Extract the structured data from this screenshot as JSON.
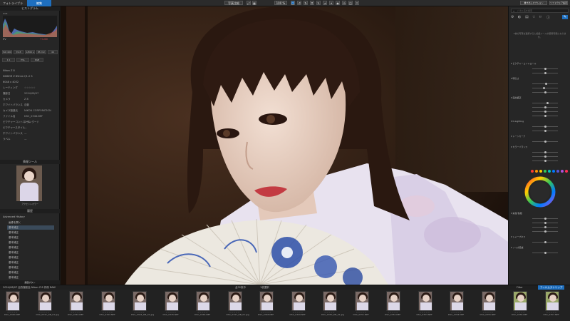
{
  "topbar": {
    "tab_library": "フォトライブラリ",
    "tab_edit": "編集",
    "mode_label": "写真比較",
    "zoom": "100 %",
    "left_tools": [
      "⤢",
      "☰"
    ],
    "right_btn1": "書き出しオプション",
    "right_btn2": "ソフトウェア設定",
    "accent": "#1e6fbf"
  },
  "left": {
    "histogram_title": "ヒストグラム",
    "exposure_value": "+1.00",
    "buttons_row1": [
      "ISO 400",
      "f/2.8",
      "1/800 s",
      "85 mm",
      "4K"
    ],
    "buttons_row2": [
      "1:1",
      "HSL",
      "RGB"
    ],
    "meta_rows": [
      {
        "k": "Nikon Z 8",
        "v": ""
      },
      {
        "k": "NIKKOR Z 85mm f/1.2 S",
        "v": ""
      },
      {
        "k": "6048 x 4032",
        "v": ""
      },
      {
        "k": "レーティング",
        "v": "☆☆☆☆☆"
      },
      {
        "k": "撮影日",
        "v": "2024/08/07"
      },
      {
        "k": "カメラ",
        "v": "Z 8"
      },
      {
        "k": "ホワイトバランス",
        "v": "自動"
      },
      {
        "k": "カメラ製造元",
        "v": "NIKON CORPORATION"
      },
      {
        "k": "ファイル名",
        "v": "DSC_0348.NEF"
      },
      {
        "k": "ピクチャーコントロール",
        "v": "スタンダード"
      },
      {
        "k": "ピクチャースタイル",
        "v": "—"
      },
      {
        "k": "ホワイトバランス",
        "v": "—"
      },
      {
        "k": "ラベル",
        "v": "—"
      }
    ],
    "preview_title": "情報ツール",
    "preview_caption": "アクセントカラー",
    "history_title": "履歴",
    "history_subtitle": "Advanced History",
    "history_items": [
      "画像を開く",
      "基本補正",
      "基本補正",
      "基本補正",
      "基本補正",
      "基本補正",
      "基本補正",
      "基本補正",
      "基本補正",
      "基本補正",
      "基本補正",
      "基本補正"
    ],
    "footer_label": "履歴ボタン"
  },
  "right": {
    "search_placeholder": "パネル名を検索",
    "info_text": "1枚の写真を選択すると編集ツールが使用可能になります。",
    "sections": [
      {
        "title": "ピクチャーコントロール",
        "sliders": [
          50,
          50
        ]
      },
      {
        "title": "明るさ",
        "sliders": [
          55,
          45,
          50
        ]
      },
      {
        "title": "露出補正",
        "sliders": [
          60,
          50,
          50,
          50
        ]
      },
      {
        "title": "D-Lighting",
        "sliders": [
          50,
          50
        ]
      },
      {
        "title": "トーンカーブ",
        "sliders": [
          50
        ]
      },
      {
        "title": "カラーバランス",
        "sliders": [
          50,
          50,
          50
        ]
      }
    ],
    "color_dots": [
      "#ff3b30",
      "#ff9500",
      "#ffcc00",
      "#34c759",
      "#00c7be",
      "#007aff",
      "#5856d6",
      "#af52de",
      "#ff2d55"
    ],
    "lower_sections": [
      {
        "title": "彩度/色相",
        "sliders": [
          50,
          50,
          50,
          50
        ]
      },
      {
        "title": "シャープネス",
        "sliders": [
          50
        ]
      },
      {
        "title": "ノイズ低減",
        "sliders": [
          50
        ]
      }
    ]
  },
  "filmbar": {
    "left_text": "2024/08/07 浴衣撮影会 Nikon Z 8 作例 RAW",
    "count": "全32枚中",
    "selected": "1枚選択",
    "right_tab1": "Filter",
    "right_tab2": "フィルムストリップ"
  },
  "thumbnails": [
    "DSC_0340.NEF",
    "DSC_0341_DB_01.jpg",
    "DSC_0342.NEF",
    "DSC_0343.NEF",
    "DSC_0344_DB_01.jpg",
    "DSC_0345.NEF",
    "DSC_0346.NEF",
    "DSC_0347_DB_01.jpg",
    "DSC_0348.NEF",
    "DSC_0349.NEF",
    "DSC_0350_DB_01.jpg",
    "DSC_0351.NEF",
    "DSC_0352.NEF",
    "DSC_0353.NEF",
    "DSC_0354.NEF",
    "DSC_0355.NEF",
    "DSC_0356.NEF",
    "DSC_0357.NEF"
  ]
}
